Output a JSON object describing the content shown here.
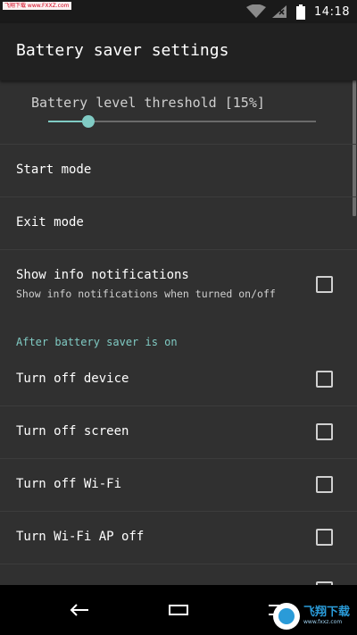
{
  "status_bar": {
    "watermark": "飞翔下载 www.FXXZ.com",
    "time": "14:18",
    "icons": [
      "wifi-icon",
      "signal-icon",
      "battery-icon"
    ]
  },
  "toolbar": {
    "title": "Battery saver settings"
  },
  "threshold": {
    "label": "Battery level threshold [15%]",
    "value_percent": 15
  },
  "rows": {
    "start_mode": {
      "title": "Start mode"
    },
    "exit_mode": {
      "title": "Exit mode"
    },
    "show_info": {
      "title": "Show info notifications",
      "subtitle": "Show info notifications when turned on/off",
      "checked": false
    }
  },
  "section_after_on": {
    "header": "After battery saver is on",
    "items": [
      {
        "title": "Turn off device",
        "checked": false
      },
      {
        "title": "Turn off screen",
        "checked": false
      },
      {
        "title": "Turn off Wi-Fi",
        "checked": false
      },
      {
        "title": "Turn Wi-Fi AP off",
        "checked": false
      }
    ]
  },
  "nav_bar": {
    "buttons": [
      "back-icon",
      "home-icon",
      "recents-icon"
    ]
  },
  "logo": {
    "text": "飞翔下载",
    "url": "www.fxxz.com"
  },
  "colors": {
    "accent": "#80cbc4",
    "background": "#303030",
    "toolbar": "#212121"
  }
}
